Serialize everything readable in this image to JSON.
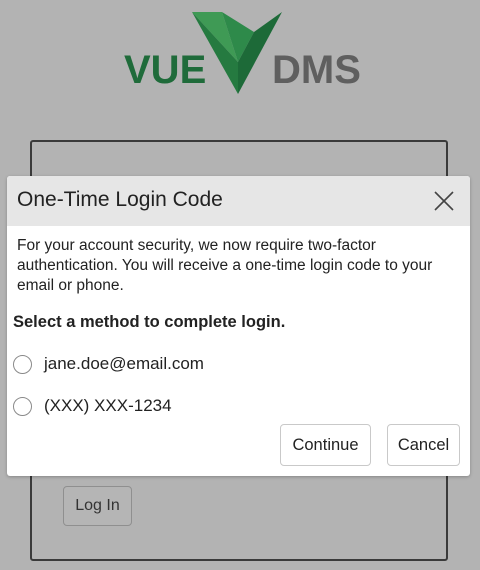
{
  "logo": {
    "left_text": "VUE",
    "right_text": "DMS",
    "brand_green": "#1f6b3a",
    "brand_light_green": "#2f8a4a",
    "gray": "#5f5f5f"
  },
  "login": {
    "button_label": "Log In"
  },
  "dialog": {
    "title": "One-Time Login Code",
    "close_icon": "close-icon",
    "description": "For your account security, we now require two-factor authentication. You will receive a one-time login code to your email or phone.",
    "method_heading": "Select a method to complete login.",
    "options": [
      {
        "label": "jane.doe@email.com",
        "selected": false
      },
      {
        "label": "(XXX) XXX-1234",
        "selected": false
      }
    ],
    "continue_label": "Continue",
    "cancel_label": "Cancel"
  }
}
